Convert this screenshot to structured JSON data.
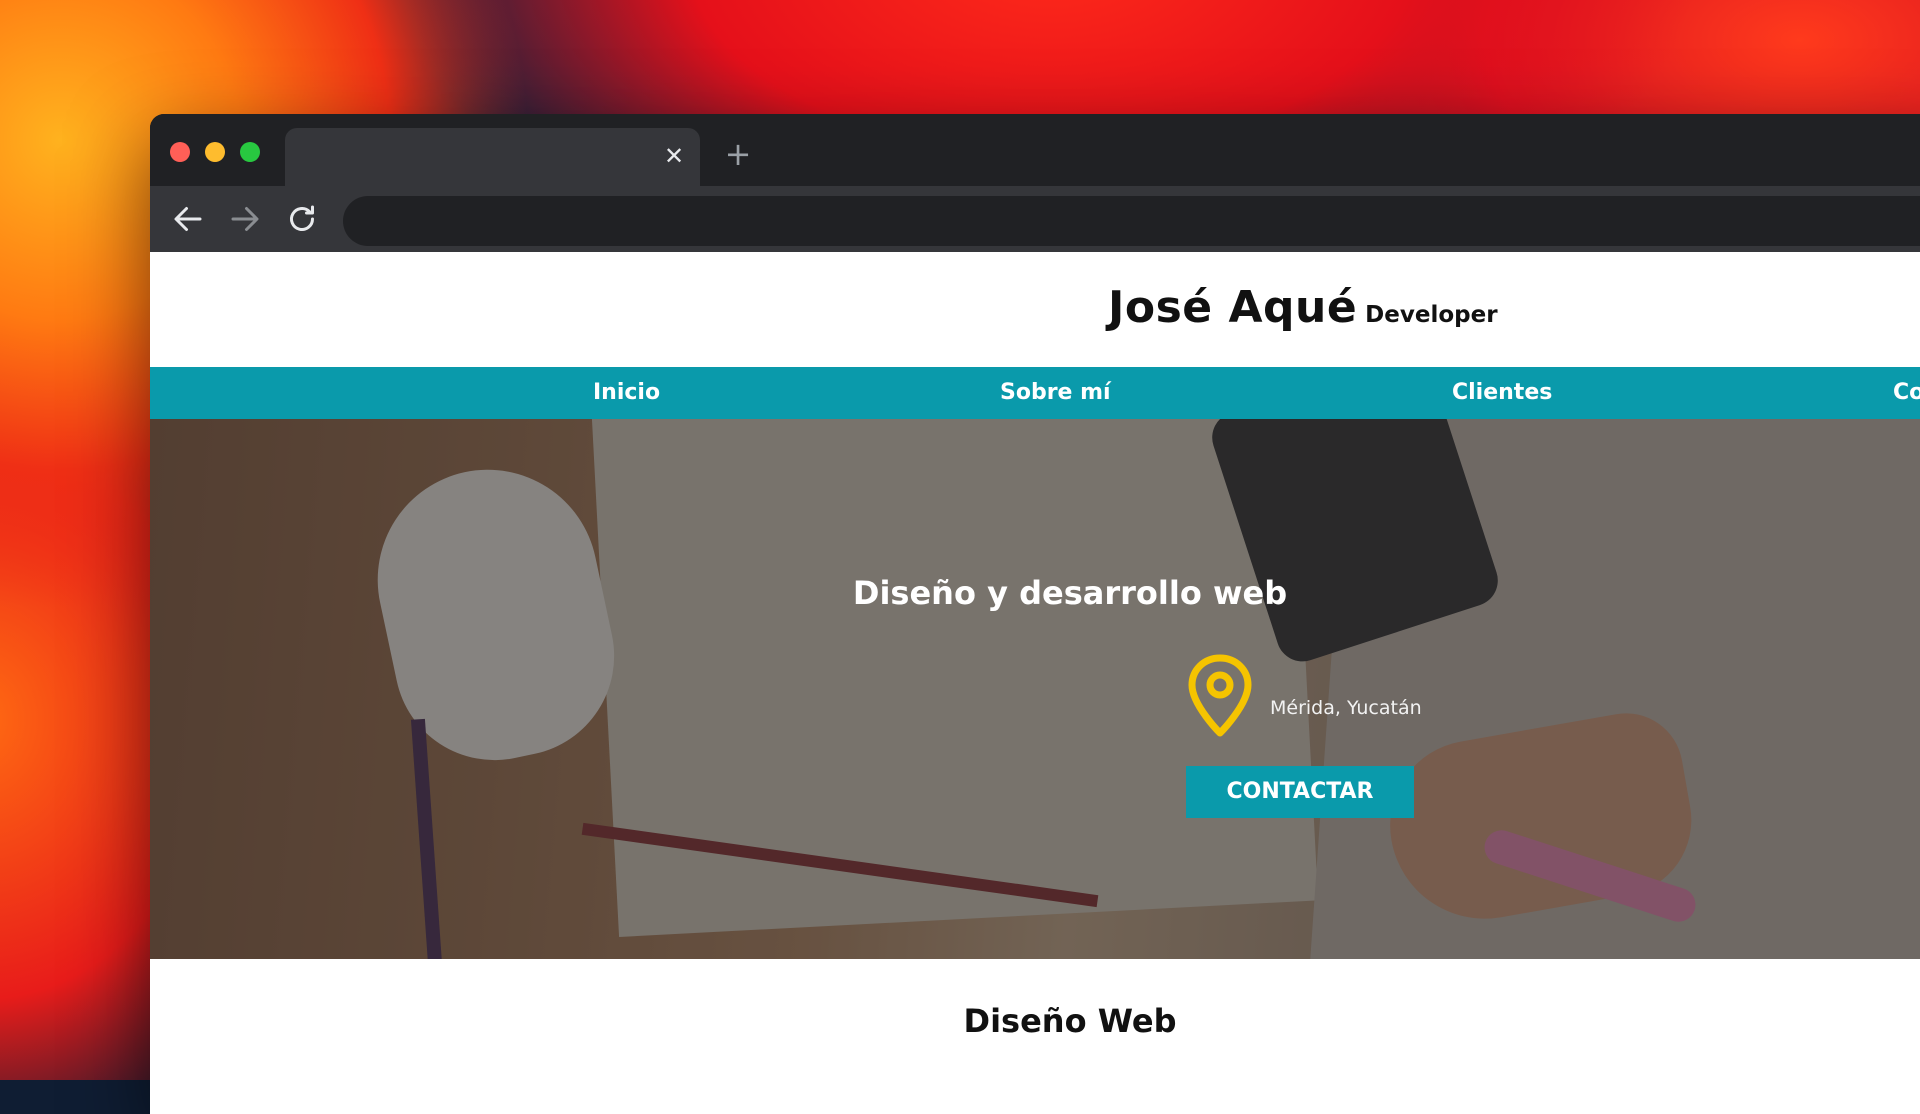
{
  "browser": {
    "tab_close_symbol": "✕",
    "new_tab_symbol": "+"
  },
  "site": {
    "brand_name": "José Aqué",
    "brand_role": "Developer",
    "nav": [
      {
        "label": "Inicio"
      },
      {
        "label": "Sobre mí"
      },
      {
        "label": "Clientes"
      },
      {
        "label": "Co"
      }
    ],
    "hero": {
      "title": "Diseño y desarrollo web",
      "location": "Mérida, Yucatán",
      "cta_label": "CONTACTAR"
    },
    "section_title": "Diseño Web"
  },
  "colors": {
    "accent": "#0a9aab",
    "pin": "#f5c400",
    "browser_chrome": "#202124",
    "toolbar": "#35363a"
  },
  "icons": {
    "back": "arrow-left-icon",
    "forward": "arrow-right-icon",
    "reload": "reload-icon",
    "location": "map-pin-icon"
  }
}
